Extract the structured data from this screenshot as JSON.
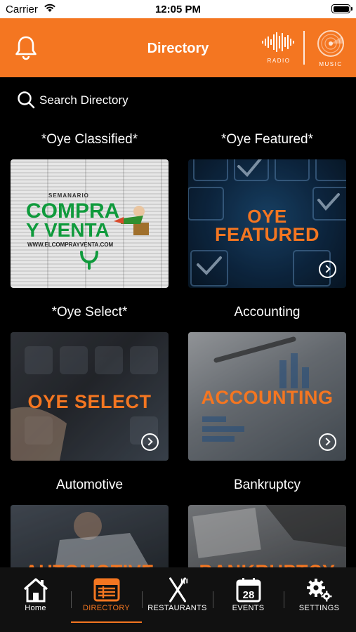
{
  "status_bar": {
    "carrier": "Carrier",
    "time": "12:05 PM"
  },
  "header": {
    "title": "Directory",
    "radio_label": "RADIO",
    "music_label": "MUSIC"
  },
  "search": {
    "placeholder": "Search Directory"
  },
  "categories": [
    {
      "title": "*Oye Classified*",
      "tile_text": ""
    },
    {
      "title": "*Oye Featured*",
      "tile_text": "FEATURED",
      "tile_brand": "OYE"
    },
    {
      "title": "*Oye Select*",
      "tile_text": "OYE SELECT"
    },
    {
      "title": "Accounting",
      "tile_text": "ACCOUNTING"
    },
    {
      "title": "Automotive",
      "tile_text": "AUTOMOTIVE"
    },
    {
      "title": "Bankruptcy",
      "tile_text": "BANKRUPTCY"
    }
  ],
  "classified_tile": {
    "semanario": "SEMANARIO",
    "line1": "COMPRA",
    "line2": "Y VENTA",
    "url": "WWW.ELCOMPRAYVENTA.COM"
  },
  "tabs": [
    {
      "label": "Home",
      "icon": "home-icon"
    },
    {
      "label": "DIRECTORY",
      "icon": "directory-icon"
    },
    {
      "label": "RESTAURANTS",
      "icon": "fork-knife-icon"
    },
    {
      "label": "EVENTS",
      "icon": "calendar-icon",
      "calendar_day": "28"
    },
    {
      "label": "SETTINGS",
      "icon": "gears-icon"
    }
  ],
  "colors": {
    "accent": "#f47621",
    "background": "#000000",
    "tabbar": "#111111"
  }
}
